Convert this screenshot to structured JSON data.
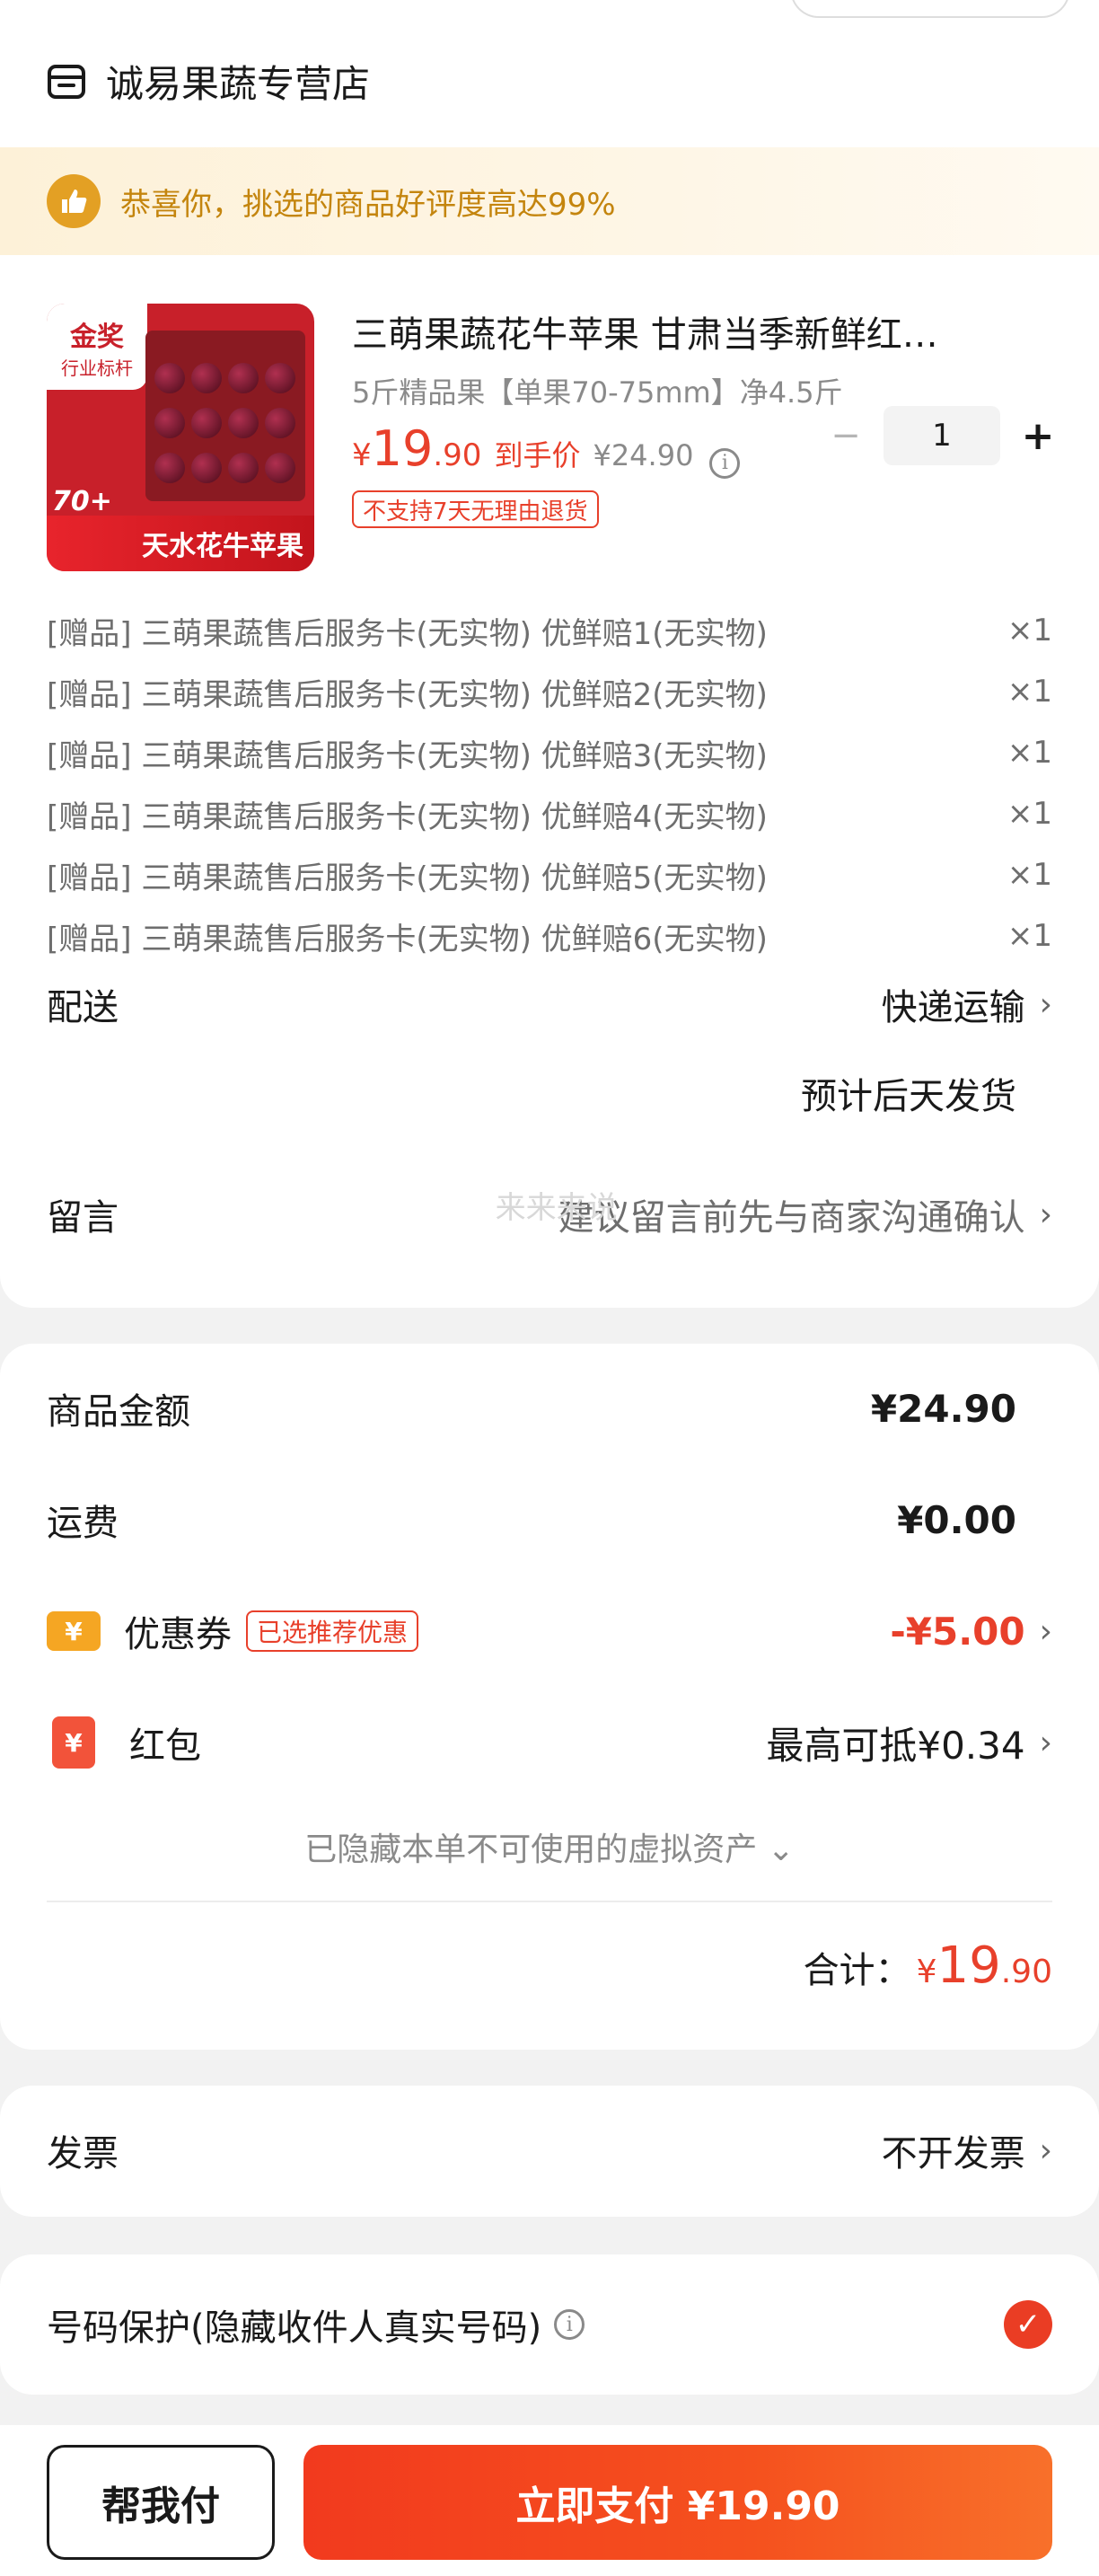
{
  "store": {
    "name": "诚易果蔬专营店"
  },
  "praise": {
    "text": "恭喜你，挑选的商品好评度高达99%"
  },
  "product": {
    "image_badge_top": "金奖",
    "image_badge_sub": "行业标杆",
    "image_banner": "天水花牛苹果",
    "image_mark": "70+",
    "title": "三萌果蔬花牛苹果 甘肃当季新鲜红…",
    "spec": "5斤精品果【单果70-75mm】净4.5斤",
    "price_symbol": "¥",
    "price_int": "19",
    "price_dec": ".90",
    "price_label": "到手价",
    "original_price": "¥24.90",
    "quantity": "1",
    "return_tag": "不支持7天无理由退货"
  },
  "gifts": [
    {
      "text": "[赠品] 三萌果蔬售后服务卡(无实物) 优鲜赔1(无实物)",
      "qty": "×1"
    },
    {
      "text": "[赠品] 三萌果蔬售后服务卡(无实物) 优鲜赔2(无实物)",
      "qty": "×1"
    },
    {
      "text": "[赠品] 三萌果蔬售后服务卡(无实物) 优鲜赔3(无实物)",
      "qty": "×1"
    },
    {
      "text": "[赠品] 三萌果蔬售后服务卡(无实物) 优鲜赔4(无实物)",
      "qty": "×1"
    },
    {
      "text": "[赠品] 三萌果蔬售后服务卡(无实物) 优鲜赔5(无实物)",
      "qty": "×1"
    },
    {
      "text": "[赠品] 三萌果蔬售后服务卡(无实物) 优鲜赔6(无实物)",
      "qty": "×1"
    }
  ],
  "shipping": {
    "label": "配送",
    "method": "快递运输",
    "eta": "预计后天发货"
  },
  "message": {
    "label": "留言",
    "ghost": "来来来说",
    "placeholder": "建议留言前先与商家沟通确认"
  },
  "amounts": {
    "goods_label": "商品金额",
    "goods_value": "¥24.90",
    "freight_label": "运费",
    "freight_value": "¥0.00",
    "coupon_icon": "¥",
    "coupon_label": "优惠券",
    "coupon_tag": "已选推荐优惠",
    "coupon_value": "-¥5.00",
    "redpack_icon": "¥",
    "redpack_label": "红包",
    "redpack_value": "最高可抵¥0.34",
    "hidden_assets": "已隐藏本单不可使用的虚拟资产 ⌄",
    "total_label": "合计：",
    "total_symbol": "¥",
    "total_int": "19",
    "total_dec": ".90"
  },
  "invoice": {
    "label": "发票",
    "value": "不开发票"
  },
  "phone_protect": {
    "label": "号码保护(隐藏收件人真实号码)",
    "checked": true
  },
  "bottom": {
    "help_label": "帮我付",
    "pay_label": "立即支付 ¥19.90"
  },
  "colors": {
    "accent": "#e8402b",
    "praise_text": "#c4850e",
    "pay_gradient_start": "#f23a1e",
    "pay_gradient_end": "#f8702a"
  }
}
